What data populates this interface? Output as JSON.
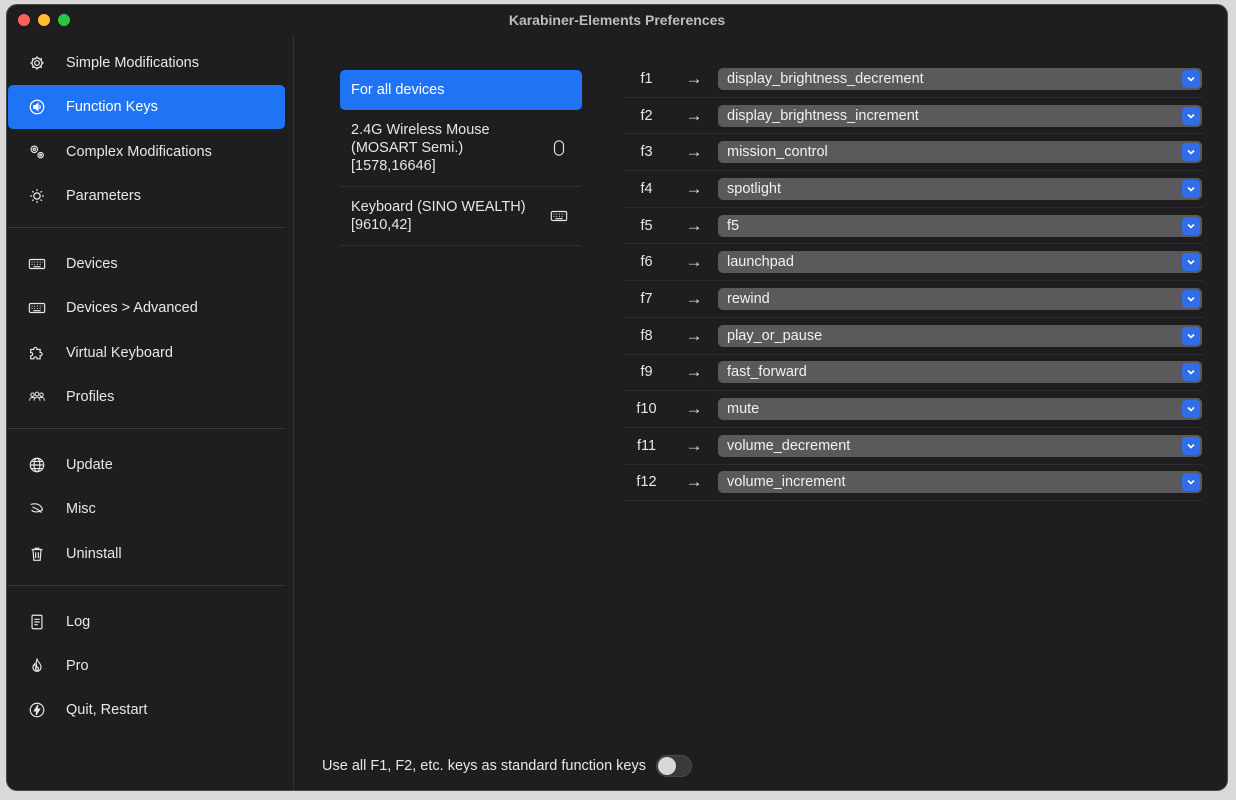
{
  "window": {
    "title": "Karabiner-Elements Preferences"
  },
  "sidebar": {
    "items": [
      {
        "label": "Simple Modifications",
        "icon": "gear-icon"
      },
      {
        "label": "Function Keys",
        "icon": "speaker-icon",
        "active": true
      },
      {
        "label": "Complex Modifications",
        "icon": "gears-icon"
      },
      {
        "label": "Parameters",
        "icon": "sun-icon"
      },
      {
        "label": "Devices",
        "icon": "keyboard-icon"
      },
      {
        "label": "Devices > Advanced",
        "icon": "keyboard-icon"
      },
      {
        "label": "Virtual Keyboard",
        "icon": "puzzle-icon"
      },
      {
        "label": "Profiles",
        "icon": "people-icon"
      },
      {
        "label": "Update",
        "icon": "globe-icon"
      },
      {
        "label": "Misc",
        "icon": "leaf-icon"
      },
      {
        "label": "Uninstall",
        "icon": "trash-icon"
      },
      {
        "label": "Log",
        "icon": "doc-icon"
      },
      {
        "label": "Pro",
        "icon": "flame-icon"
      },
      {
        "label": "Quit, Restart",
        "icon": "bolt-icon"
      }
    ]
  },
  "devices": [
    {
      "lines": [
        "For all devices"
      ],
      "active": true,
      "icon": ""
    },
    {
      "lines": [
        "2.4G Wireless Mouse",
        "(MOSART Semi.)",
        "[1578,16646]"
      ],
      "icon": "mouse-icon"
    },
    {
      "lines": [
        "Keyboard (SINO WEALTH)",
        "[9610,42]"
      ],
      "icon": "keyboard-icon"
    }
  ],
  "keys": [
    {
      "key": "f1",
      "arrow": "→",
      "value": "display_brightness_decrement"
    },
    {
      "key": "f2",
      "arrow": "→",
      "value": "display_brightness_increment"
    },
    {
      "key": "f3",
      "arrow": "→",
      "value": "mission_control"
    },
    {
      "key": "f4",
      "arrow": "→",
      "value": "spotlight"
    },
    {
      "key": "f5",
      "arrow": "→",
      "value": "f5"
    },
    {
      "key": "f6",
      "arrow": "→",
      "value": "launchpad"
    },
    {
      "key": "f7",
      "arrow": "→",
      "value": "rewind"
    },
    {
      "key": "f8",
      "arrow": "→",
      "value": "play_or_pause"
    },
    {
      "key": "f9",
      "arrow": "→",
      "value": "fast_forward"
    },
    {
      "key": "f10",
      "arrow": "→",
      "value": "mute"
    },
    {
      "key": "f11",
      "arrow": "→",
      "value": "volume_decrement"
    },
    {
      "key": "f12",
      "arrow": "→",
      "value": "volume_increment"
    }
  ],
  "footer": {
    "label": "Use all F1, F2, etc. keys as standard function keys",
    "toggle_on": false
  },
  "colors": {
    "accent": "#1e74f5",
    "background": "#1e1e20",
    "select": "#5a5a5c"
  }
}
